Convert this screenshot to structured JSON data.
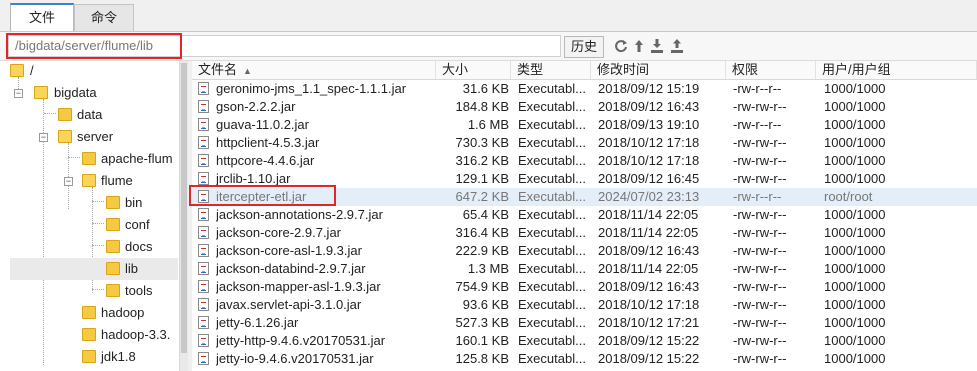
{
  "tabs": [
    {
      "label": "文件",
      "active": true
    },
    {
      "label": "命令",
      "active": false
    }
  ],
  "path": {
    "value": "/bigdata/server/flume/lib"
  },
  "toolbar": {
    "history_label": "历史",
    "icons": [
      "refresh-icon",
      "up-icon",
      "download-icon",
      "upload-icon"
    ]
  },
  "tree": {
    "root": "/",
    "items": [
      {
        "label": "/"
      },
      {
        "label": "bigdata"
      },
      {
        "label": "data"
      },
      {
        "label": "server"
      },
      {
        "label": "apache-flum"
      },
      {
        "label": "flume"
      },
      {
        "label": "bin"
      },
      {
        "label": "conf"
      },
      {
        "label": "docs"
      },
      {
        "label": "lib"
      },
      {
        "label": "tools"
      },
      {
        "label": "hadoop"
      },
      {
        "label": "hadoop-3.3."
      },
      {
        "label": "jdk1.8"
      }
    ]
  },
  "table": {
    "headers": [
      "文件名",
      "大小",
      "类型",
      "修改时间",
      "权限",
      "用户/用户组"
    ],
    "rows": [
      {
        "name": "geronimo-jms_1.1_spec-1.1.1.jar",
        "size": "31.6 KB",
        "type": "Executabl...",
        "mtime": "2018/09/12 15:19",
        "perm": "-rw-r--r--",
        "owner": "1000/1000"
      },
      {
        "name": "gson-2.2.2.jar",
        "size": "184.8 KB",
        "type": "Executabl...",
        "mtime": "2018/09/12 16:43",
        "perm": "-rw-rw-r--",
        "owner": "1000/1000"
      },
      {
        "name": "guava-11.0.2.jar",
        "size": "1.6 MB",
        "type": "Executabl...",
        "mtime": "2018/09/13 19:10",
        "perm": "-rw-r--r--",
        "owner": "1000/1000"
      },
      {
        "name": "httpclient-4.5.3.jar",
        "size": "730.3 KB",
        "type": "Executabl...",
        "mtime": "2018/10/12 17:18",
        "perm": "-rw-rw-r--",
        "owner": "1000/1000"
      },
      {
        "name": "httpcore-4.4.6.jar",
        "size": "316.2 KB",
        "type": "Executabl...",
        "mtime": "2018/10/12 17:18",
        "perm": "-rw-rw-r--",
        "owner": "1000/1000"
      },
      {
        "name": "jrclib-1.10.jar",
        "size": "129.1 KB",
        "type": "Executabl...",
        "mtime": "2018/09/12 16:45",
        "perm": "-rw-rw-r--",
        "owner": "1000/1000"
      },
      {
        "name": "itercepter-etl.jar",
        "size": "647.2 KB",
        "type": "Executabl...",
        "mtime": "2024/07/02 23:13",
        "perm": "-rw-r--r--",
        "owner": "root/root",
        "highlight": true
      },
      {
        "name": "jackson-annotations-2.9.7.jar",
        "size": "65.4 KB",
        "type": "Executabl...",
        "mtime": "2018/11/14 22:05",
        "perm": "-rw-rw-r--",
        "owner": "1000/1000"
      },
      {
        "name": "jackson-core-2.9.7.jar",
        "size": "316.4 KB",
        "type": "Executabl...",
        "mtime": "2018/11/14 22:05",
        "perm": "-rw-rw-r--",
        "owner": "1000/1000"
      },
      {
        "name": "jackson-core-asl-1.9.3.jar",
        "size": "222.9 KB",
        "type": "Executabl...",
        "mtime": "2018/09/12 16:43",
        "perm": "-rw-rw-r--",
        "owner": "1000/1000"
      },
      {
        "name": "jackson-databind-2.9.7.jar",
        "size": "1.3 MB",
        "type": "Executabl...",
        "mtime": "2018/11/14 22:05",
        "perm": "-rw-rw-r--",
        "owner": "1000/1000"
      },
      {
        "name": "jackson-mapper-asl-1.9.3.jar",
        "size": "754.9 KB",
        "type": "Executabl...",
        "mtime": "2018/09/12 16:43",
        "perm": "-rw-rw-r--",
        "owner": "1000/1000"
      },
      {
        "name": "javax.servlet-api-3.1.0.jar",
        "size": "93.6 KB",
        "type": "Executabl...",
        "mtime": "2018/10/12 17:18",
        "perm": "-rw-rw-r--",
        "owner": "1000/1000"
      },
      {
        "name": "jetty-6.1.26.jar",
        "size": "527.3 KB",
        "type": "Executabl...",
        "mtime": "2018/10/12 17:21",
        "perm": "-rw-rw-r--",
        "owner": "1000/1000"
      },
      {
        "name": "jetty-http-9.4.6.v20170531.jar",
        "size": "160.1 KB",
        "type": "Executabl...",
        "mtime": "2018/09/12 15:22",
        "perm": "-rw-rw-r--",
        "owner": "1000/1000"
      },
      {
        "name": "jetty-io-9.4.6.v20170531.jar",
        "size": "125.8 KB",
        "type": "Executabl...",
        "mtime": "2018/09/12 15:22",
        "perm": "-rw-rw-r--",
        "owner": "1000/1000"
      }
    ]
  },
  "colors": {
    "highlight_row": "#e4eef8",
    "annotation": "#e0252b",
    "folder": "#f6c945"
  }
}
